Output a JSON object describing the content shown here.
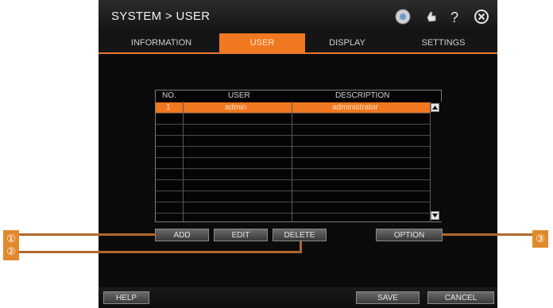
{
  "window": {
    "title": "SYSTEM > USER",
    "icons": [
      "settings-gear-icon",
      "pointer-hand-icon",
      "help-icon",
      "close-icon"
    ]
  },
  "tabs": [
    {
      "label": "INFORMATION",
      "active": false
    },
    {
      "label": "USER",
      "active": true
    },
    {
      "label": "DISPLAY",
      "active": false
    },
    {
      "label": "SETTINGS",
      "active": false
    }
  ],
  "user_table": {
    "columns": [
      "NO.",
      "USER",
      "DESCRIPTION"
    ],
    "rows": [
      {
        "no": "1",
        "user": "admin",
        "description": "administrator",
        "selected": true
      }
    ]
  },
  "buttons": {
    "add": "ADD",
    "edit": "EDIT",
    "delete": "DELETE",
    "option": "OPTION",
    "help": "HELP",
    "save": "SAVE",
    "cancel": "CANCEL"
  },
  "callouts": [
    "①",
    "②",
    "③"
  ],
  "colors": {
    "accent": "#f07820",
    "callout": "#e08a2c"
  }
}
